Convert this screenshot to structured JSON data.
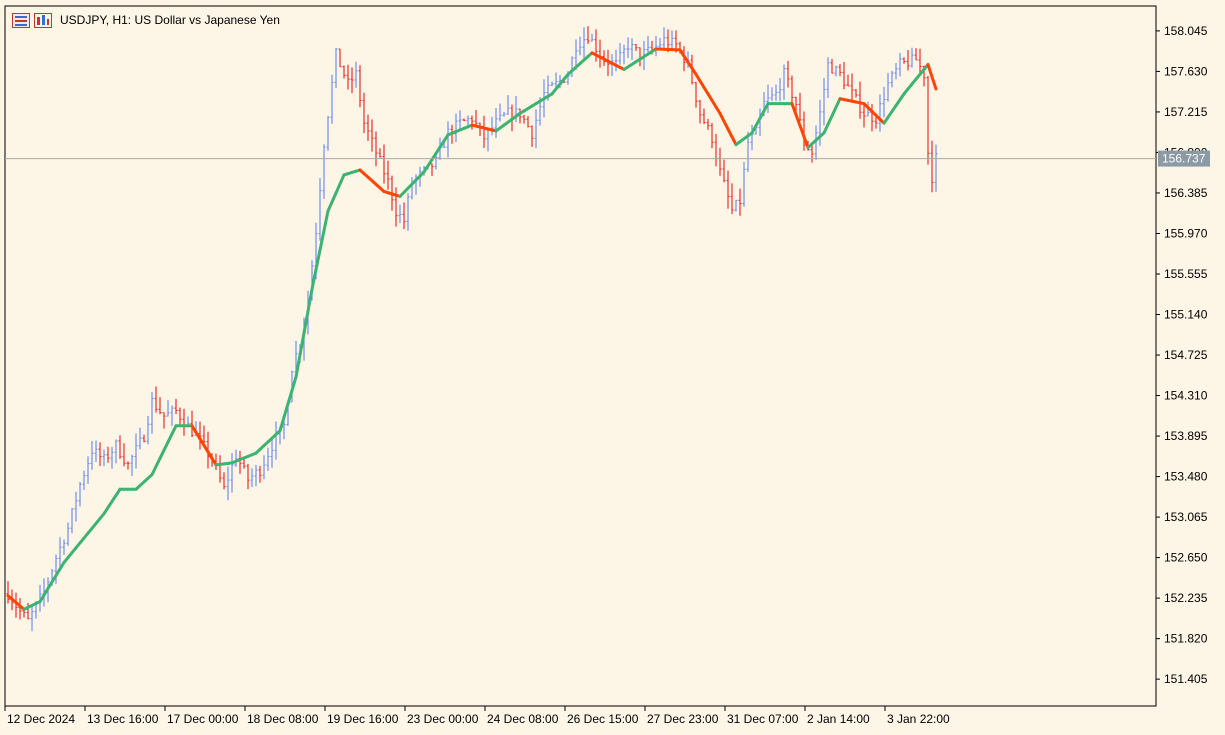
{
  "window": {
    "title": "USDJPY, H1:  US Dollar vs Japanese Yen"
  },
  "icons": [
    "bars-panel-icon",
    "chart-window-icon"
  ],
  "colors": {
    "background": "#fdf5e6",
    "bull_bar": "#6f8fe8",
    "bear_bar": "#e8302e",
    "ma_rising": "#3cb371",
    "ma_falling": "#ff4500",
    "price_line": "#a9a9a9",
    "price_label_bg": "#8c9aa5",
    "frame": "#000000"
  },
  "chart_data": {
    "type": "ohlc",
    "symbol": "USDJPY",
    "timeframe": "H1",
    "y_axis": {
      "ticks": [
        158.045,
        157.63,
        157.215,
        156.8,
        156.385,
        155.97,
        155.555,
        155.14,
        154.725,
        154.31,
        153.895,
        153.48,
        153.065,
        152.65,
        152.235,
        151.82,
        151.405
      ],
      "tick_labels": [
        "158.045",
        "157.630",
        "157.215",
        "156.800",
        "156.385",
        "155.970",
        "155.555",
        "155.140",
        "154.725",
        "154.310",
        "153.895",
        "153.480",
        "153.065",
        "152.650",
        "152.235",
        "151.820",
        "151.405"
      ],
      "range": [
        151.13,
        158.3
      ]
    },
    "x_axis": {
      "tick_labels": [
        "12 Dec 2024",
        "13 Dec 16:00",
        "17 Dec 00:00",
        "18 Dec 08:00",
        "19 Dec 16:00",
        "23 Dec 00:00",
        "24 Dec 08:00",
        "26 Dec 15:00",
        "27 Dec 23:00",
        "31 Dec 07:00",
        "2 Jan 14:00",
        "3 Jan 22:00"
      ],
      "tick_bar_index": [
        0,
        20,
        40,
        60,
        80,
        100,
        120,
        140,
        160,
        180,
        200,
        220
      ]
    },
    "current_price": 156.737,
    "current_price_label": "156.737",
    "moving_average": {
      "anchors": [
        [
          0,
          152.26
        ],
        [
          4,
          152.12
        ],
        [
          8,
          152.2
        ],
        [
          14,
          152.6
        ],
        [
          20,
          152.9
        ],
        [
          24,
          153.1
        ],
        [
          28,
          153.35
        ],
        [
          32,
          153.35
        ],
        [
          36,
          153.5
        ],
        [
          42,
          154.0
        ],
        [
          46,
          154.0
        ],
        [
          52,
          153.6
        ],
        [
          56,
          153.62
        ],
        [
          62,
          153.72
        ],
        [
          68,
          153.95
        ],
        [
          72,
          154.5
        ],
        [
          76,
          155.4
        ],
        [
          80,
          156.2
        ],
        [
          84,
          156.57
        ],
        [
          88,
          156.62
        ],
        [
          94,
          156.4
        ],
        [
          98,
          156.35
        ],
        [
          104,
          156.6
        ],
        [
          110,
          156.98
        ],
        [
          116,
          157.08
        ],
        [
          122,
          157.02
        ],
        [
          128,
          157.2
        ],
        [
          136,
          157.4
        ],
        [
          140,
          157.6
        ],
        [
          146,
          157.82
        ],
        [
          154,
          157.65
        ],
        [
          162,
          157.86
        ],
        [
          168,
          157.85
        ],
        [
          172,
          157.6
        ],
        [
          178,
          157.2
        ],
        [
          182,
          156.88
        ],
        [
          186,
          157.0
        ],
        [
          190,
          157.3
        ],
        [
          196,
          157.3
        ],
        [
          200,
          156.85
        ],
        [
          204,
          157.0
        ],
        [
          208,
          157.35
        ],
        [
          214,
          157.3
        ],
        [
          219,
          157.1
        ],
        [
          224,
          157.4
        ],
        [
          230,
          157.7
        ],
        [
          232,
          157.45
        ]
      ]
    },
    "candles": {
      "count": 233,
      "anchors": [
        [
          0,
          152.28
        ],
        [
          3,
          152.1
        ],
        [
          5,
          152.0
        ],
        [
          9,
          152.3
        ],
        [
          12,
          152.65
        ],
        [
          15,
          152.95
        ],
        [
          18,
          153.4
        ],
        [
          21,
          153.75
        ],
        [
          24,
          153.65
        ],
        [
          27,
          153.8
        ],
        [
          30,
          153.6
        ],
        [
          34,
          153.9
        ],
        [
          36,
          154.25
        ],
        [
          39,
          154.1
        ],
        [
          42,
          154.15
        ],
        [
          45,
          154.0
        ],
        [
          48,
          153.85
        ],
        [
          51,
          153.65
        ],
        [
          54,
          153.35
        ],
        [
          57,
          153.7
        ],
        [
          60,
          153.45
        ],
        [
          63,
          153.55
        ],
        [
          66,
          153.8
        ],
        [
          69,
          154.0
        ],
        [
          71,
          154.6
        ],
        [
          73,
          154.85
        ],
        [
          75,
          155.3
        ],
        [
          77,
          156.0
        ],
        [
          79,
          156.9
        ],
        [
          82,
          157.8
        ],
        [
          85,
          157.5
        ],
        [
          87,
          157.6
        ],
        [
          89,
          157.1
        ],
        [
          92,
          156.8
        ],
        [
          95,
          156.5
        ],
        [
          97,
          156.2
        ],
        [
          99,
          156.1
        ],
        [
          101,
          156.5
        ],
        [
          104,
          156.6
        ],
        [
          107,
          156.7
        ],
        [
          110,
          157.0
        ],
        [
          113,
          157.1
        ],
        [
          116,
          157.15
        ],
        [
          119,
          156.95
        ],
        [
          122,
          157.1
        ],
        [
          125,
          157.2
        ],
        [
          128,
          157.2
        ],
        [
          131,
          157.0
        ],
        [
          134,
          157.4
        ],
        [
          137,
          157.5
        ],
        [
          140,
          157.6
        ],
        [
          142,
          157.9
        ],
        [
          145,
          158.0
        ],
        [
          149,
          157.75
        ],
        [
          152,
          157.7
        ],
        [
          155,
          157.9
        ],
        [
          158,
          157.8
        ],
        [
          161,
          157.85
        ],
        [
          164,
          157.95
        ],
        [
          167,
          157.9
        ],
        [
          170,
          157.7
        ],
        [
          173,
          157.2
        ],
        [
          176,
          156.95
        ],
        [
          178,
          156.6
        ],
        [
          181,
          156.2
        ],
        [
          183,
          156.3
        ],
        [
          185,
          156.9
        ],
        [
          187,
          157.0
        ],
        [
          189,
          157.3
        ],
        [
          192,
          157.4
        ],
        [
          194,
          157.6
        ],
        [
          197,
          157.3
        ],
        [
          199,
          156.9
        ],
        [
          201,
          156.8
        ],
        [
          203,
          157.2
        ],
        [
          205,
          157.7
        ],
        [
          208,
          157.6
        ],
        [
          211,
          157.4
        ],
        [
          214,
          157.2
        ],
        [
          217,
          157.15
        ],
        [
          220,
          157.5
        ],
        [
          223,
          157.7
        ],
        [
          227,
          157.75
        ],
        [
          229,
          157.6
        ],
        [
          230,
          156.8
        ],
        [
          231,
          156.55
        ],
        [
          232,
          156.74
        ]
      ]
    }
  }
}
